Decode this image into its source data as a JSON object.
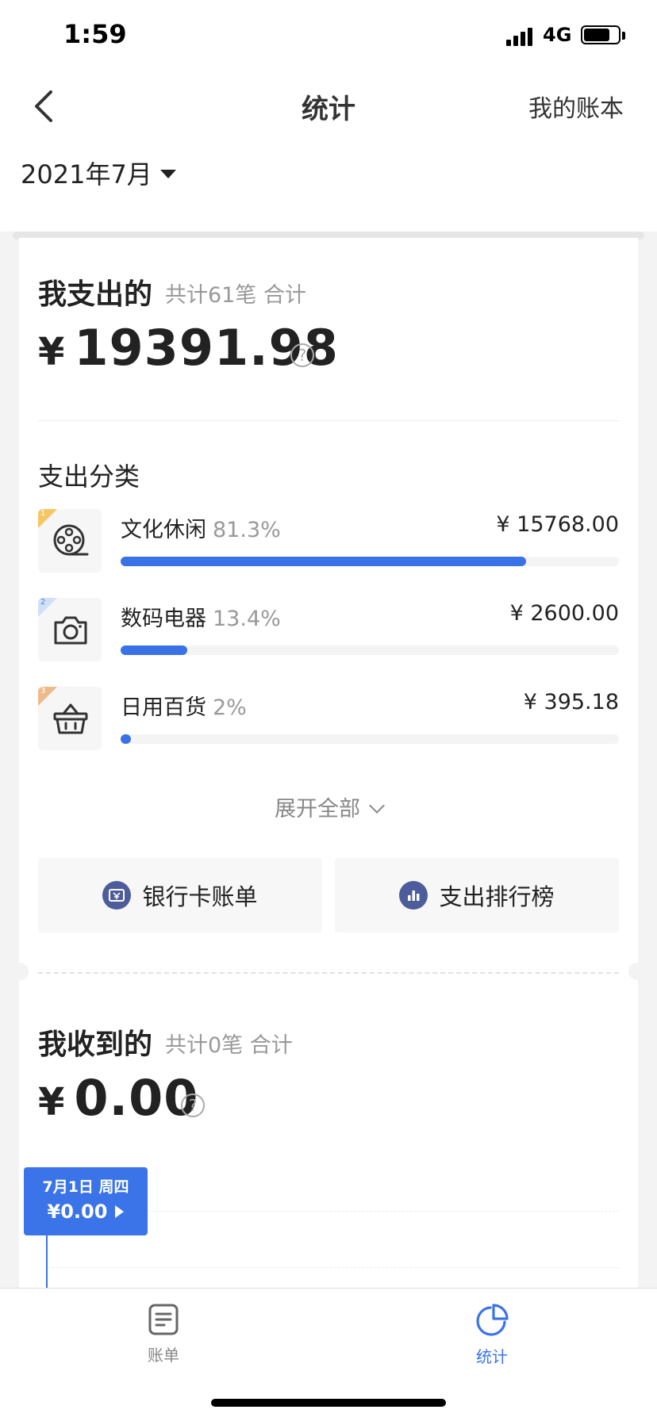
{
  "status_bar": {
    "time": "1:59",
    "network": "4G",
    "battery_level": 0.75
  },
  "nav": {
    "title": "统计",
    "right_label": "我的账本",
    "back_icon": "chevron-left-icon"
  },
  "month": {
    "label": "2021年7月"
  },
  "expense": {
    "title": "我支出的",
    "subtitle": "共计61笔 合计",
    "currency": "¥",
    "amount": "19391.98",
    "help": "?",
    "categories_heading": "支出分类",
    "categories": [
      {
        "rank": "1",
        "name": "文化休闲",
        "percent": "81.3%",
        "amount": "¥ 15768.00",
        "share": 0.813,
        "icon": "film-reel-icon",
        "badge_color": "#f5c663"
      },
      {
        "rank": "2",
        "name": "数码电器",
        "percent": "13.4%",
        "amount": "¥ 2600.00",
        "share": 0.134,
        "icon": "camera-icon",
        "badge_color": "#cfe0f7"
      },
      {
        "rank": "3",
        "name": "日用百货",
        "percent": "2%",
        "amount": "¥ 395.18",
        "share": 0.02,
        "icon": "shopping-basket-icon",
        "badge_color": "#f0b98a"
      }
    ],
    "expand_label": "展开全部",
    "actions": [
      {
        "label": "银行卡账单",
        "icon": "bank-card-icon"
      },
      {
        "label": "支出排行榜",
        "icon": "bar-chart-icon"
      }
    ]
  },
  "income": {
    "title": "我收到的",
    "subtitle": "共计0笔 合计",
    "currency": "¥",
    "amount": "0.00",
    "help": "?",
    "tooltip": {
      "date": "7月1日 周四",
      "value": "¥0.00"
    }
  },
  "tabs": [
    {
      "label": "账单",
      "icon": "bill-icon",
      "active": false
    },
    {
      "label": "统计",
      "icon": "pie-chart-icon",
      "active": true
    }
  ],
  "colors": {
    "accent": "#3972e6",
    "active_tab": "#3b74e8",
    "inactive_tab": "#888888"
  }
}
